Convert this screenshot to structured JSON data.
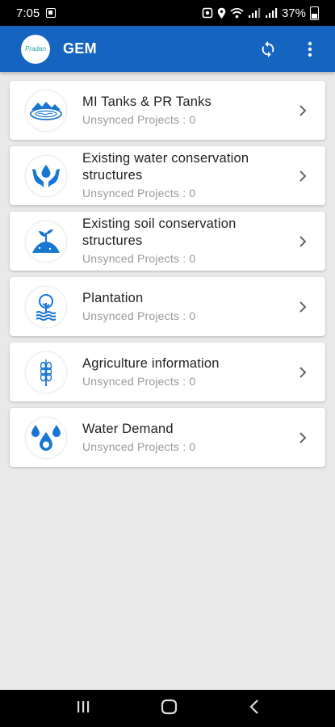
{
  "status_bar": {
    "time": "7:05",
    "battery": "37%",
    "icons": [
      "message-icon",
      "alarm-icon",
      "location-icon",
      "wifi-icon",
      "signal-icon",
      "signal-icon",
      "battery-icon"
    ]
  },
  "app_bar": {
    "logo_text": "Pradan",
    "title": "GEM",
    "actions": [
      "sync-icon",
      "more-vert-icon"
    ]
  },
  "items": [
    {
      "title": "MI Tanks & PR Tanks",
      "subtitle": "Unsynced Projects : 0",
      "icon": "tank-icon"
    },
    {
      "title": "Existing water conservation structures",
      "subtitle": "Unsynced Projects : 0",
      "icon": "water-hands-icon"
    },
    {
      "title": "Existing soil conservation structures",
      "subtitle": "Unsynced Projects : 0",
      "icon": "soil-sprout-icon"
    },
    {
      "title": "Plantation",
      "subtitle": "Unsynced Projects : 0",
      "icon": "tree-icon"
    },
    {
      "title": "Agriculture information",
      "subtitle": "Unsynced Projects : 0",
      "icon": "wheat-icon"
    },
    {
      "title": "Water Demand",
      "subtitle": "Unsynced Projects : 0",
      "icon": "water-drops-icon"
    }
  ],
  "colors": {
    "primary": "#1565c0",
    "icon_blue": "#1976d2",
    "background": "#e9e9e9"
  },
  "nav_bar": [
    "recents-icon",
    "home-icon",
    "back-icon"
  ]
}
